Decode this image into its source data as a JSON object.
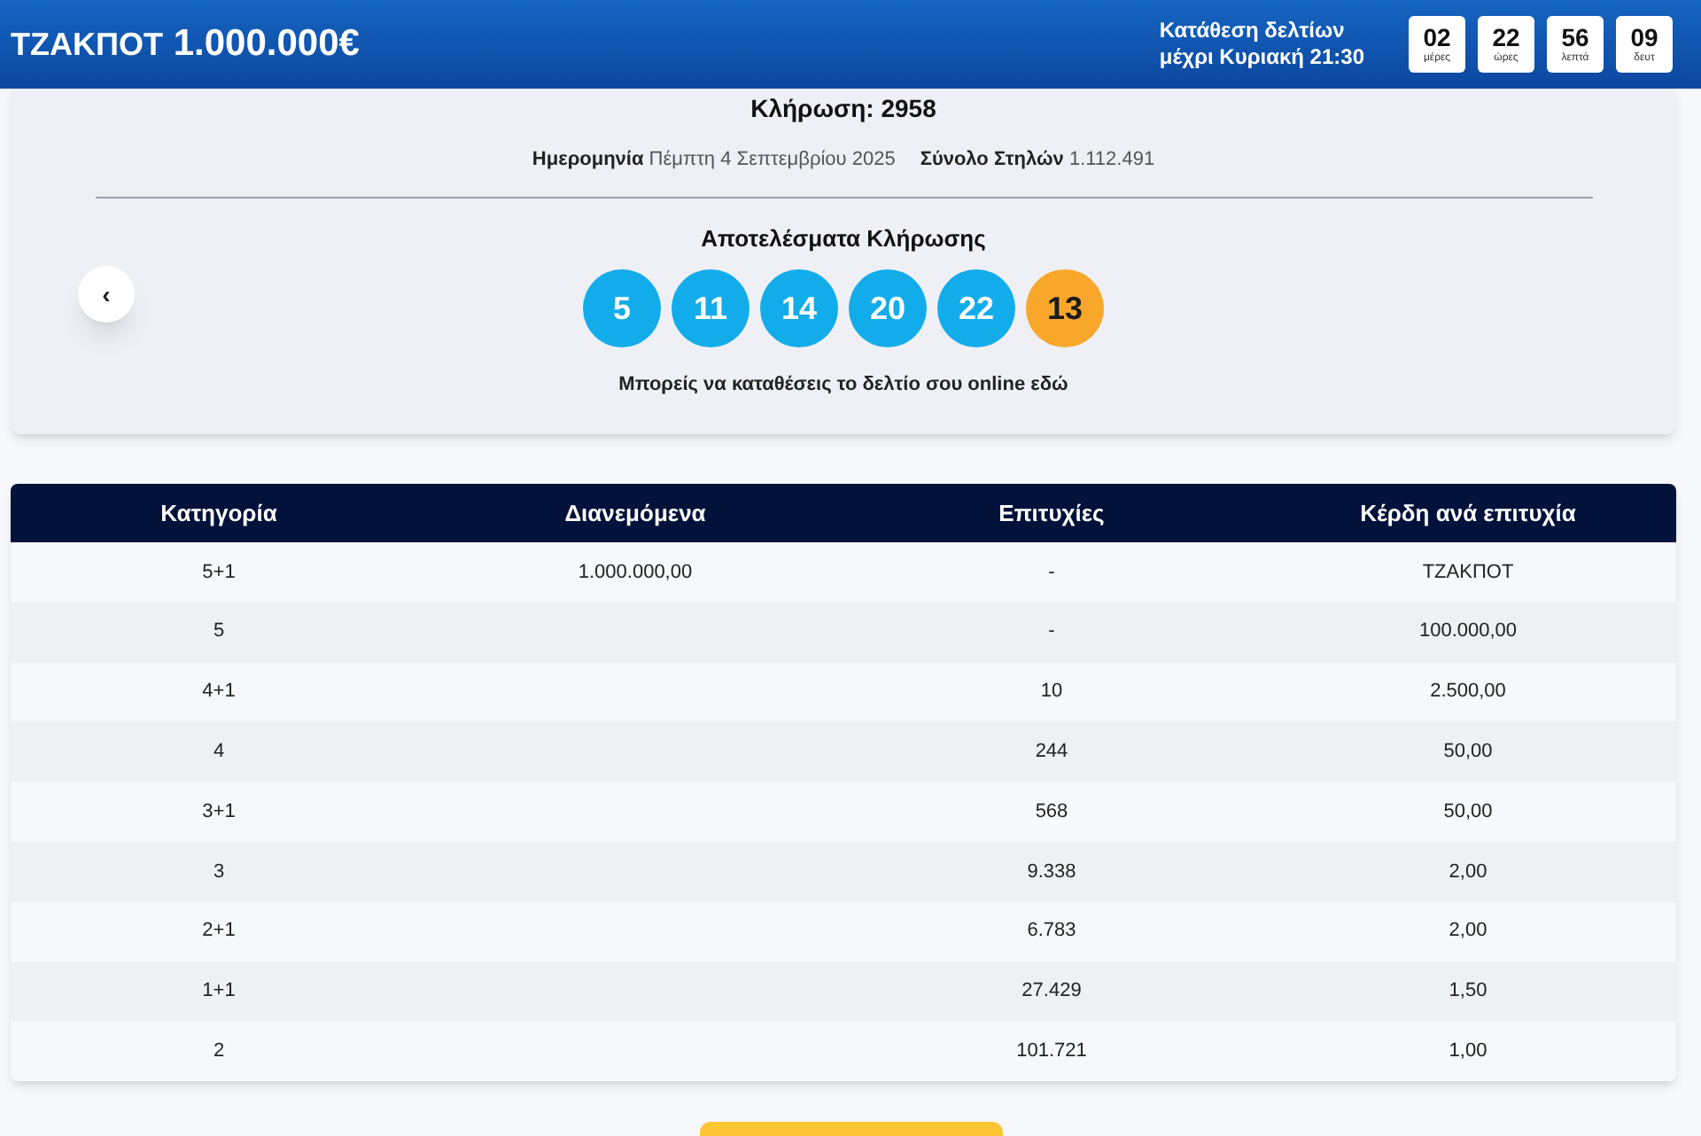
{
  "header": {
    "jackpot_label": "ΤΖΑΚΠΟΤ",
    "jackpot_amount": "1.000.000€",
    "deadline_line1": "Κατάθεση δελτίων",
    "deadline_line2": "μέχρι Κυριακή 21:30",
    "countdown": [
      {
        "value": "02",
        "unit": "μέρες"
      },
      {
        "value": "22",
        "unit": "ώρες"
      },
      {
        "value": "56",
        "unit": "λεπτά"
      },
      {
        "value": "09",
        "unit": "δευτ"
      }
    ]
  },
  "draw": {
    "title": "Κλήρωση: 2958",
    "date_label": "Ημερομηνία",
    "date_value": "Πέμπτη 4 Σεπτεμβρίου 2025",
    "columns_label": "Σύνολο Στηλών",
    "columns_value": "1.112.491",
    "results_title": "Αποτελέσματα Κλήρωσης",
    "prev_button": "‹",
    "balls": [
      {
        "number": "5",
        "kind": "main"
      },
      {
        "number": "11",
        "kind": "main"
      },
      {
        "number": "14",
        "kind": "main"
      },
      {
        "number": "20",
        "kind": "main"
      },
      {
        "number": "22",
        "kind": "main"
      },
      {
        "number": "13",
        "kind": "bonus"
      }
    ],
    "online_text": "Μπορείς να καταθέσεις το δελτίο σου online εδώ"
  },
  "table": {
    "columns": [
      "Κατηγορία",
      "Διανεμόμενα",
      "Επιτυχίες",
      "Κέρδη ανά επιτυχία"
    ],
    "rows": [
      [
        "5+1",
        "1.000.000,00",
        "-",
        "ΤΖΑΚΠΟΤ"
      ],
      [
        "5",
        "",
        "-",
        "100.000,00"
      ],
      [
        "4+1",
        "",
        "10",
        "2.500,00"
      ],
      [
        "4",
        "",
        "244",
        "50,00"
      ],
      [
        "3+1",
        "",
        "568",
        "50,00"
      ],
      [
        "3",
        "",
        "9.338",
        "2,00"
      ],
      [
        "2+1",
        "",
        "6.783",
        "2,00"
      ],
      [
        "1+1",
        "",
        "27.429",
        "1,50"
      ],
      [
        "2",
        "",
        "101.721",
        "1,00"
      ]
    ]
  }
}
